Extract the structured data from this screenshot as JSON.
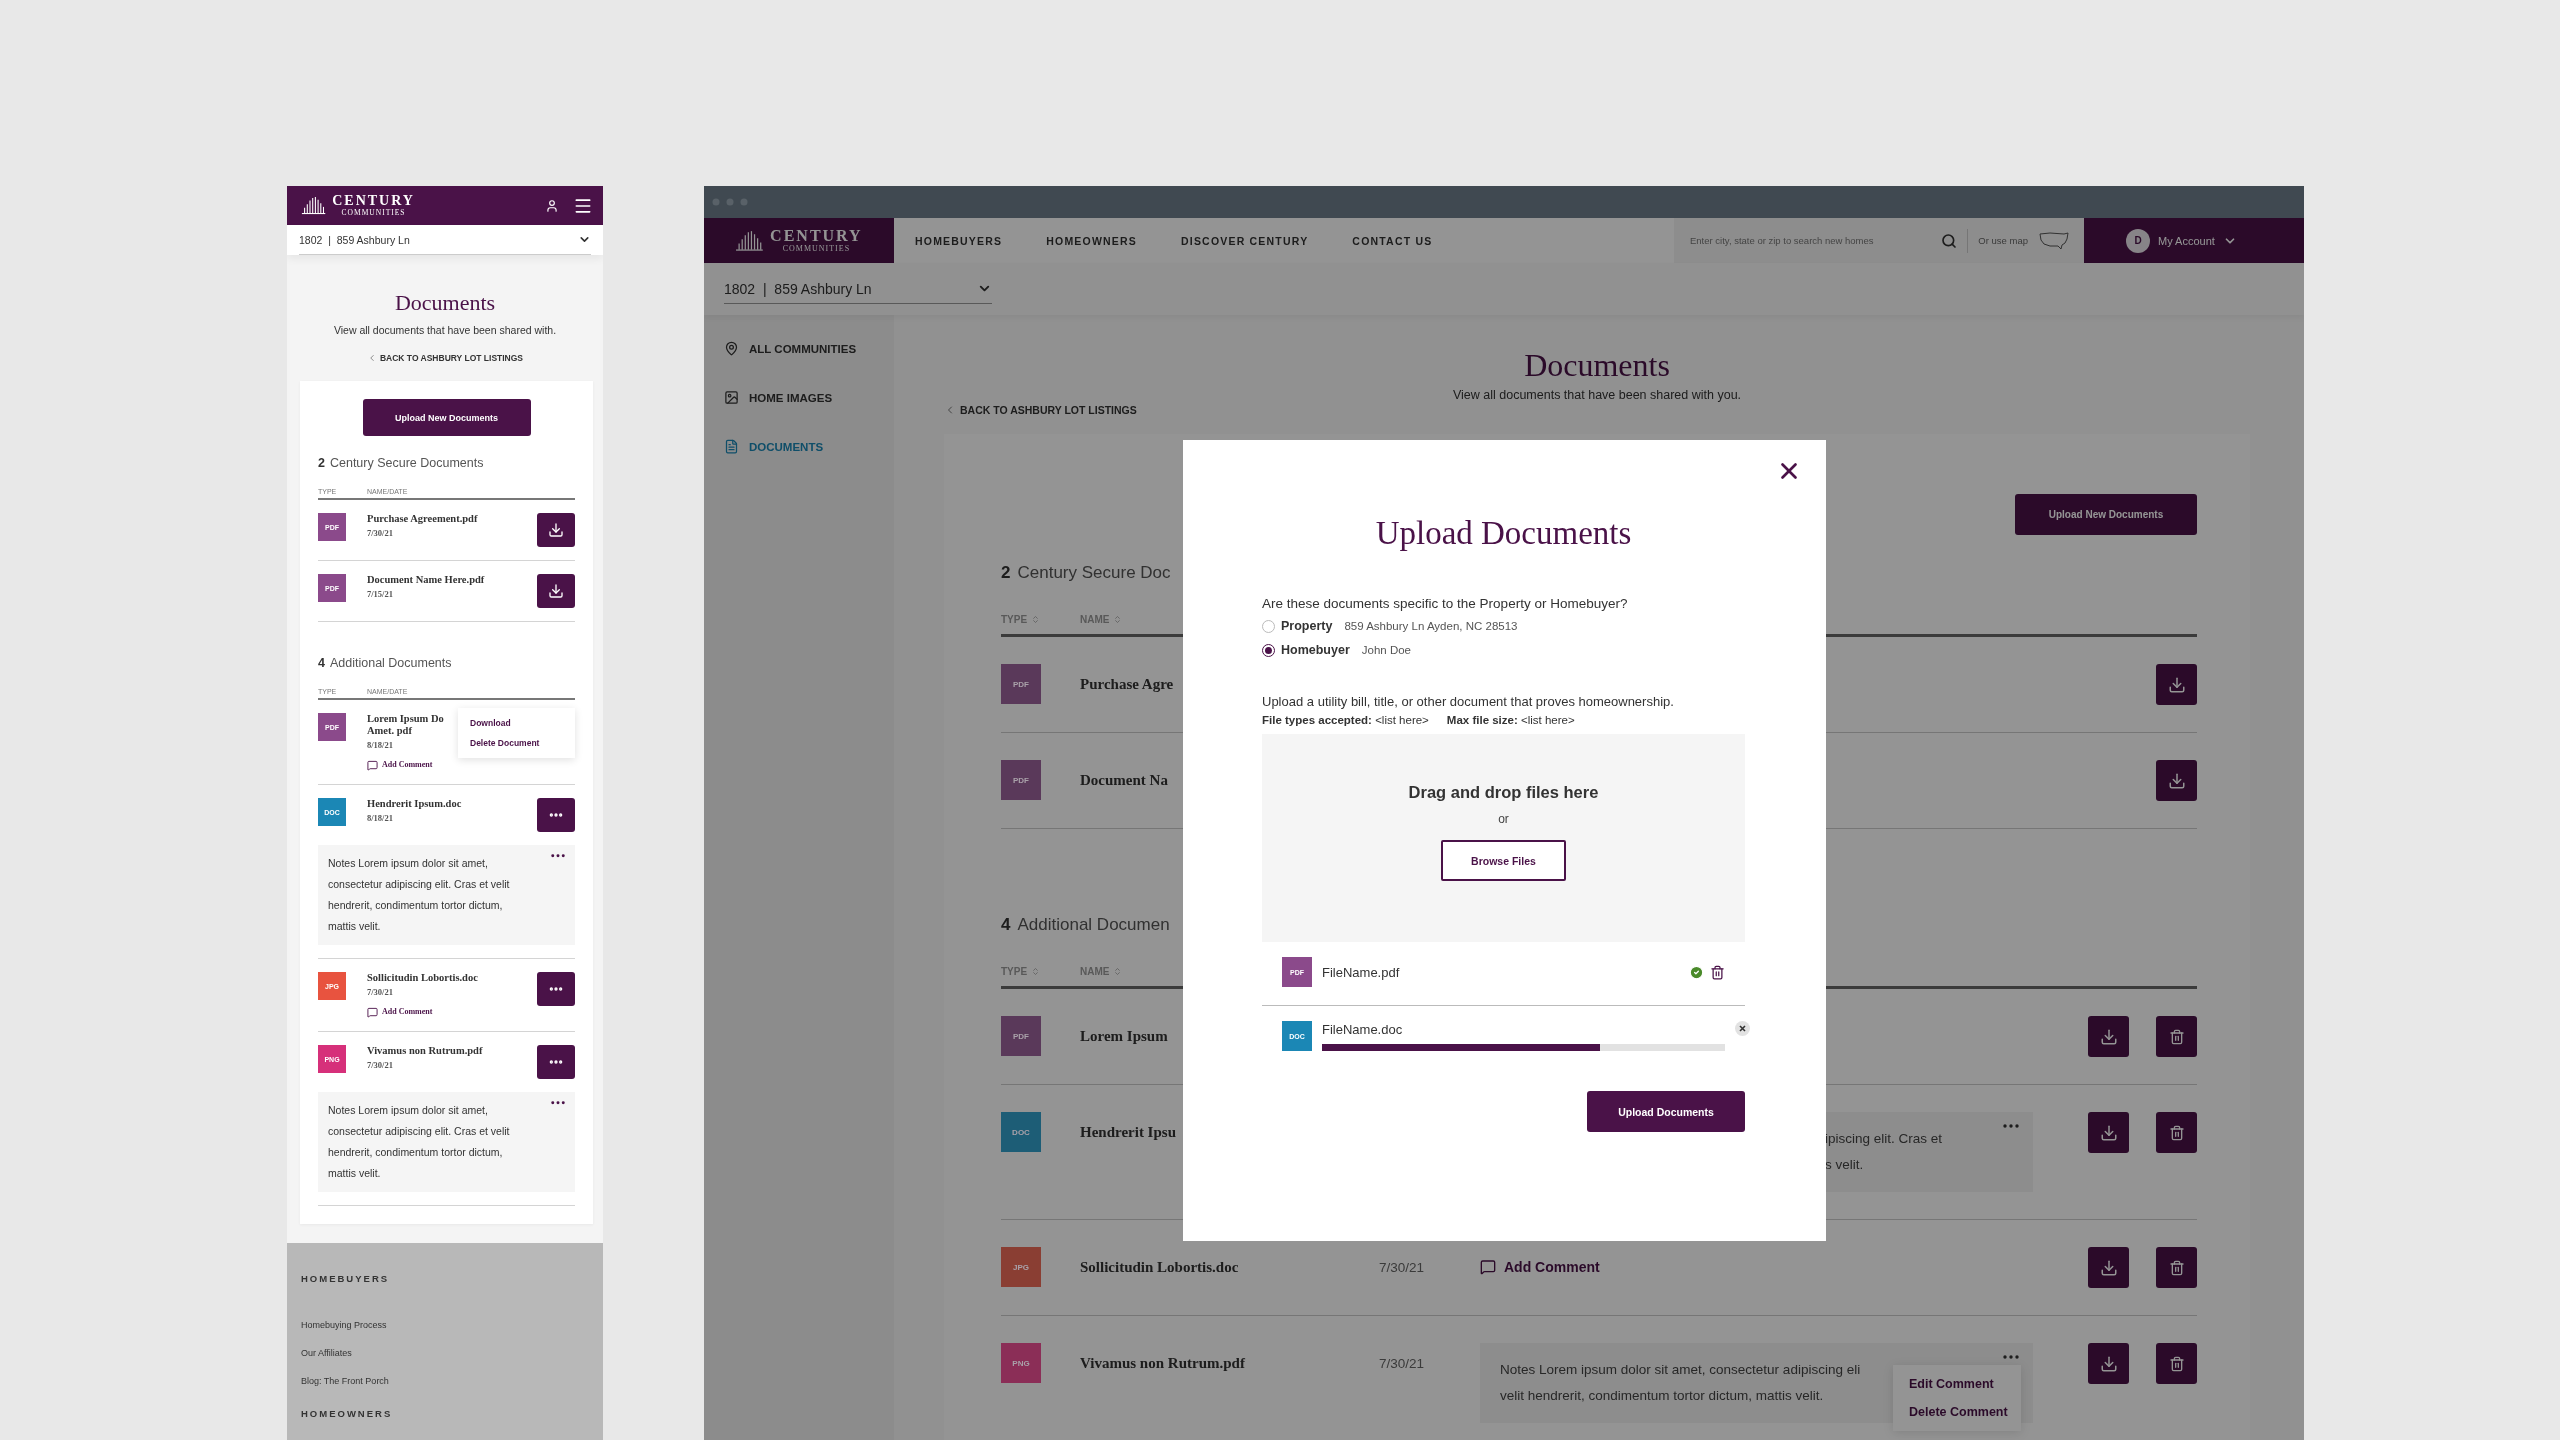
{
  "mobile": {
    "logo": {
      "name": "CENTURY",
      "tagline": "COMMUNITIES"
    },
    "address": "1802  |  859 Ashbury Ln",
    "title": "Documents",
    "subtitle": "View all documents that have been shared with.",
    "back_link": "BACK TO ASHBURY LOT LISTINGS",
    "upload_button": "Upload New Documents",
    "sections": [
      {
        "count": "2",
        "title": "Century Secure Documents",
        "columns": [
          "TYPE",
          "NAME/DATE"
        ],
        "rows": [
          {
            "type": "PDF",
            "color": "#8b4a8b",
            "name_lines": [
              "Purchase Agreement.pdf"
            ],
            "date": "7/30/21",
            "kind": "download"
          },
          {
            "type": "PDF",
            "color": "#8b4a8b",
            "name_lines": [
              "Document Name Here.pdf"
            ],
            "date": "7/15/21",
            "kind": "download"
          }
        ]
      },
      {
        "count": "4",
        "title": "Additional Documents",
        "columns": [
          "TYPE",
          "NAME/DATE"
        ],
        "rows": [
          {
            "type": "PDF",
            "color": "#8b4a8b",
            "name_lines": [
              "Lorem Ipsum Do",
              "Amet. pdf"
            ],
            "date": "8/18/21",
            "comment": "Add Comment",
            "kind": "menu",
            "menu": [
              "Download",
              "Delete Document"
            ]
          },
          {
            "type": "DOC",
            "color": "#1b87b5",
            "name_lines": [
              "Hendrerit Ipsum.doc"
            ],
            "date": "8/18/21",
            "kind": "more",
            "note": "Notes Lorem ipsum dolor sit amet, consectetur adipiscing elit. Cras et velit hendrerit, condimentum tortor dictum, mattis velit."
          },
          {
            "type": "JPG",
            "color": "#e8533f",
            "name_lines": [
              "Sollicitudin Lobortis.doc"
            ],
            "date": "7/30/21",
            "comment": "Add Comment",
            "kind": "more"
          },
          {
            "type": "PNG",
            "color": "#d6307a",
            "name_lines": [
              "Vivamus non Rutrum.pdf"
            ],
            "date": "7/30/21",
            "kind": "more",
            "note": "Notes Lorem ipsum dolor sit amet, consectetur adipiscing elit. Cras et velit hendrerit, condimentum tortor dictum, mattis velit."
          }
        ]
      }
    ],
    "footer": {
      "heading": "HOMEBUYERS",
      "links": [
        "Homebuying Process",
        "Our Affiliates",
        "Blog: The Front Porch"
      ],
      "next_heading": "HOMEOWNERS"
    }
  },
  "desktop": {
    "logo": {
      "name": "CENTURY",
      "tagline": "COMMUNITIES"
    },
    "nav": [
      "HOMEBUYERS",
      "HOMEOWNERS",
      "DISCOVER CENTURY",
      "CONTACT US"
    ],
    "search": {
      "placeholder": "Enter city, state or zip to search new homes"
    },
    "map_link": "Or use map",
    "account": {
      "initial": "D",
      "label": "My Account"
    },
    "address": "1802  |  859 Ashbury Ln",
    "sidebar": [
      {
        "label": "ALL COMMUNITIES",
        "selected": false
      },
      {
        "label": "HOME IMAGES",
        "selected": false
      },
      {
        "label": "DOCUMENTS",
        "selected": true
      }
    ],
    "title": "Documents",
    "subtitle": "View all documents that have been shared with you.",
    "back_link": "BACK TO ASHBURY LOT LISTINGS",
    "upload_button": "Upload New Documents",
    "sections": [
      {
        "count": "2",
        "title": "Century Secure Doc",
        "kind": "secure",
        "columns": [
          "TYPE",
          "NAME"
        ],
        "rows": [
          {
            "type": "PDF",
            "color": "#5a395a",
            "name": "Purchase Agre"
          },
          {
            "type": "PDF",
            "color": "#5a395a",
            "name": "Document Na"
          }
        ]
      },
      {
        "count": "4",
        "title": "Additional Documen",
        "kind": "additional",
        "columns": [
          "TYPE",
          "NAME"
        ],
        "rows": [
          {
            "type": "PDF",
            "color": "#5a395a",
            "name": "Lorem Ipsum"
          },
          {
            "type": "DOC",
            "color": "#1d5d76",
            "name": "Hendrerit Ipsu",
            "note": {
              "kind": "covered",
              "lines": [
                "ipiscing elit. Cras et",
                "s velit."
              ]
            }
          },
          {
            "type": "JPG",
            "color": "#8a3e33",
            "name": "Sollicitudin Lobortis.doc",
            "date": "7/30/21",
            "comment": "Add Comment"
          },
          {
            "type": "PNG",
            "color": "#8b2e57",
            "name": "Vivamus non Rutrum.pdf",
            "date": "7/30/21",
            "note": {
              "kind": "full",
              "lines": [
                "Notes Lorem ipsum dolor sit amet, consectetur adipiscing eli",
                "velit hendrerit, condimentum tortor dictum, mattis velit."
              ],
              "menu": [
                "Edit Comment",
                "Delete Comment"
              ]
            }
          }
        ]
      }
    ]
  },
  "modal": {
    "title": "Upload Documents",
    "question": "Are these documents specific to the Property or Homebuyer?",
    "options": [
      {
        "label": "Property",
        "detail": "859 Ashbury Ln Ayden, NC 28513",
        "selected": false
      },
      {
        "label": "Homebuyer",
        "detail": "John Doe",
        "selected": true
      }
    ],
    "instructions": "Upload a utility bill, title, or other document that proves homeownership.",
    "file_types": "**File types accepted:** <list here>",
    "max_size": "**Max file size:** <list here>",
    "drop_title": "Drag and drop files here",
    "drop_or": "or",
    "browse_button": "Browse Files",
    "files": [
      {
        "type": "PDF",
        "color": "#8b4a8b",
        "name": "FileName.pdf",
        "kind": "done"
      },
      {
        "type": "DOC",
        "color": "#1b87b5",
        "name": "FileName.doc",
        "kind": "uploading",
        "level": 0.69
      }
    ],
    "submit_button": "Upload Documents"
  }
}
